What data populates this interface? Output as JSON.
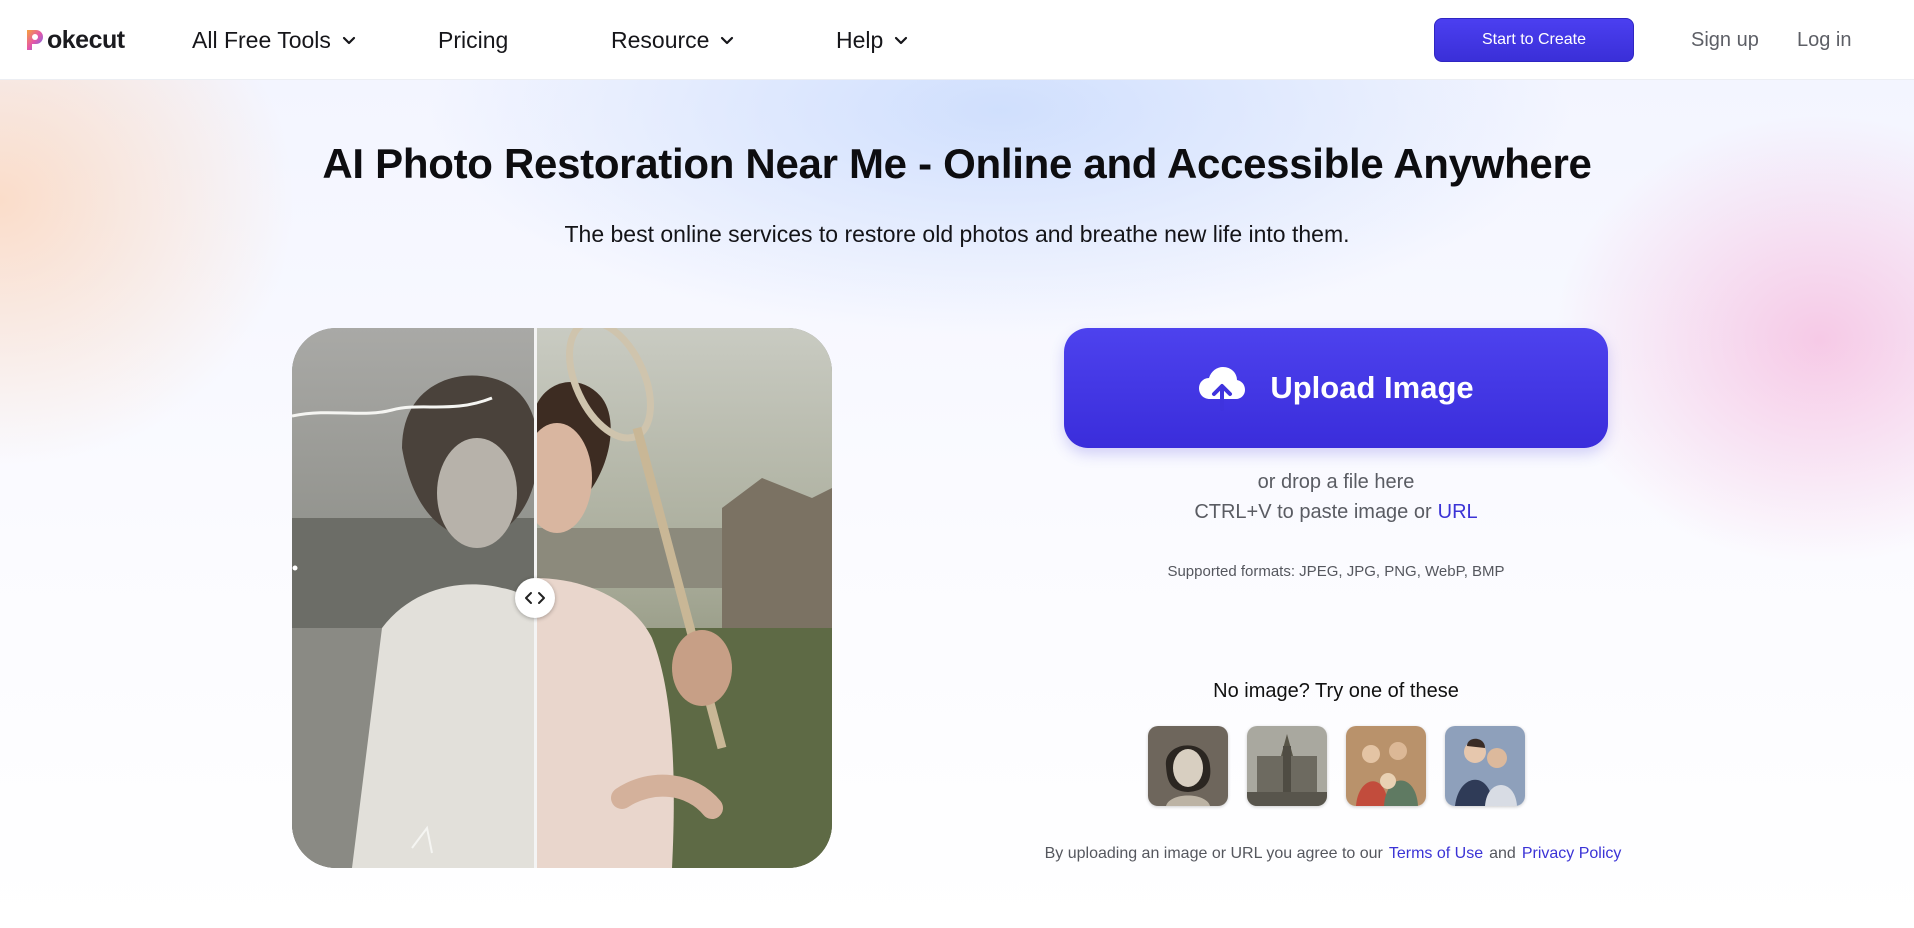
{
  "header": {
    "logo_text": "okecut",
    "nav": {
      "all_free_tools": "All Free Tools",
      "pricing": "Pricing",
      "resource": "Resource",
      "help": "Help"
    },
    "cta_label": "Start to Create",
    "signup_label": "Sign up",
    "login_label": "Log in"
  },
  "hero": {
    "title": "AI Photo Restoration Near Me - Online and Accessible Anywhere",
    "subtitle": "The best online services to restore old photos and breathe new life into them."
  },
  "upload": {
    "button_label": "Upload Image",
    "drop_text": "or drop a file here",
    "paste_text": "CTRL+V to paste image or",
    "url_label": "URL",
    "formats_text": "Supported formats: JPEG, JPG, PNG, WebP, BMP"
  },
  "samples": {
    "title": "No image? Try one of these"
  },
  "terms": {
    "prefix": "By uploading an image or URL you agree to our",
    "terms_label": "Terms of Use",
    "and": "and",
    "privacy_label": "Privacy Policy"
  },
  "colors": {
    "accent": "#3b33d6",
    "cta": "#4b3ff0"
  },
  "icons": {
    "logo": "pokecut-logo-mark",
    "nav_chevron": "chevron-down-icon",
    "upload": "cloud-upload-icon",
    "handle": "compare-arrows-icon"
  }
}
